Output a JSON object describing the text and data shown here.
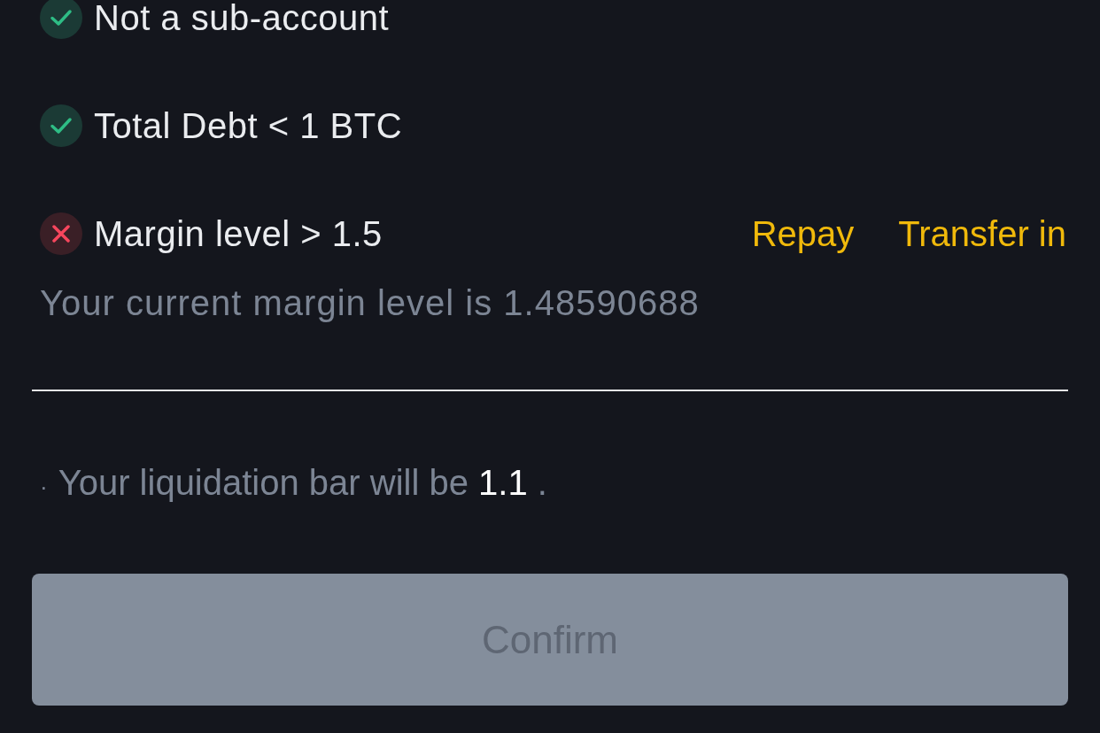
{
  "conditions": [
    {
      "label": "Not a sub-account",
      "met": true
    },
    {
      "label": "Total Debt < 1 BTC",
      "met": true
    },
    {
      "label": "Margin level > 1.5",
      "met": false,
      "actions": [
        "Repay",
        "Transfer in"
      ],
      "note": "Your current margin level is 1.48590688"
    }
  ],
  "liquidation_note": {
    "bullet": "·",
    "text": "Your liquidation bar will be",
    "value": "1.1",
    "suffix": "."
  },
  "confirm_button": {
    "label": "Confirm",
    "disabled": true
  }
}
